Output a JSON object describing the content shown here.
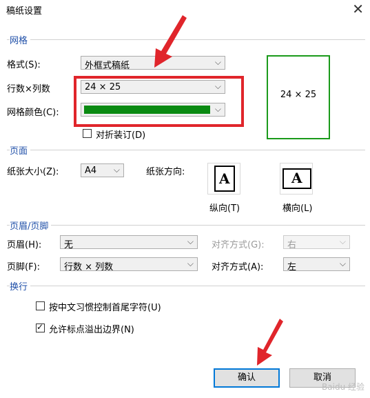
{
  "window": {
    "title": "稿纸设置",
    "close_symbol": "✕"
  },
  "grid_section": {
    "label": "网格",
    "format_label": "格式(S):",
    "format_value": "外框式稿纸",
    "rows_cols_label": "行数×列数",
    "rows_cols_value": "24 × 25",
    "color_label": "网格颜色(C):",
    "color_value": "#0a8a12",
    "fold_label": "对折装订(D)",
    "fold_checked": false,
    "preview_text": "24 × 25"
  },
  "page_section": {
    "label": "页面",
    "size_label": "纸张大小(Z):",
    "size_value": "A4",
    "orientation_label": "纸张方向:",
    "portrait_label": "纵向(T)",
    "landscape_label": "横向(L)",
    "icon_letter": "A"
  },
  "header_footer_section": {
    "label": "页眉/页脚",
    "header_label": "页眉(H):",
    "header_value": "无",
    "header_align_label": "对齐方式(G):",
    "header_align_value": "右",
    "footer_label": "页脚(F):",
    "footer_value": "行数 × 列数",
    "footer_align_label": "对齐方式(A):",
    "footer_align_value": "左"
  },
  "wrap_section": {
    "label": "换行",
    "option1_label": "按中文习惯控制首尾字符(U)",
    "option1_checked": false,
    "option2_label": "允许标点溢出边界(N)",
    "option2_checked": true
  },
  "buttons": {
    "ok": "确认",
    "cancel": "取消"
  },
  "watermark": "Baidu 经验"
}
